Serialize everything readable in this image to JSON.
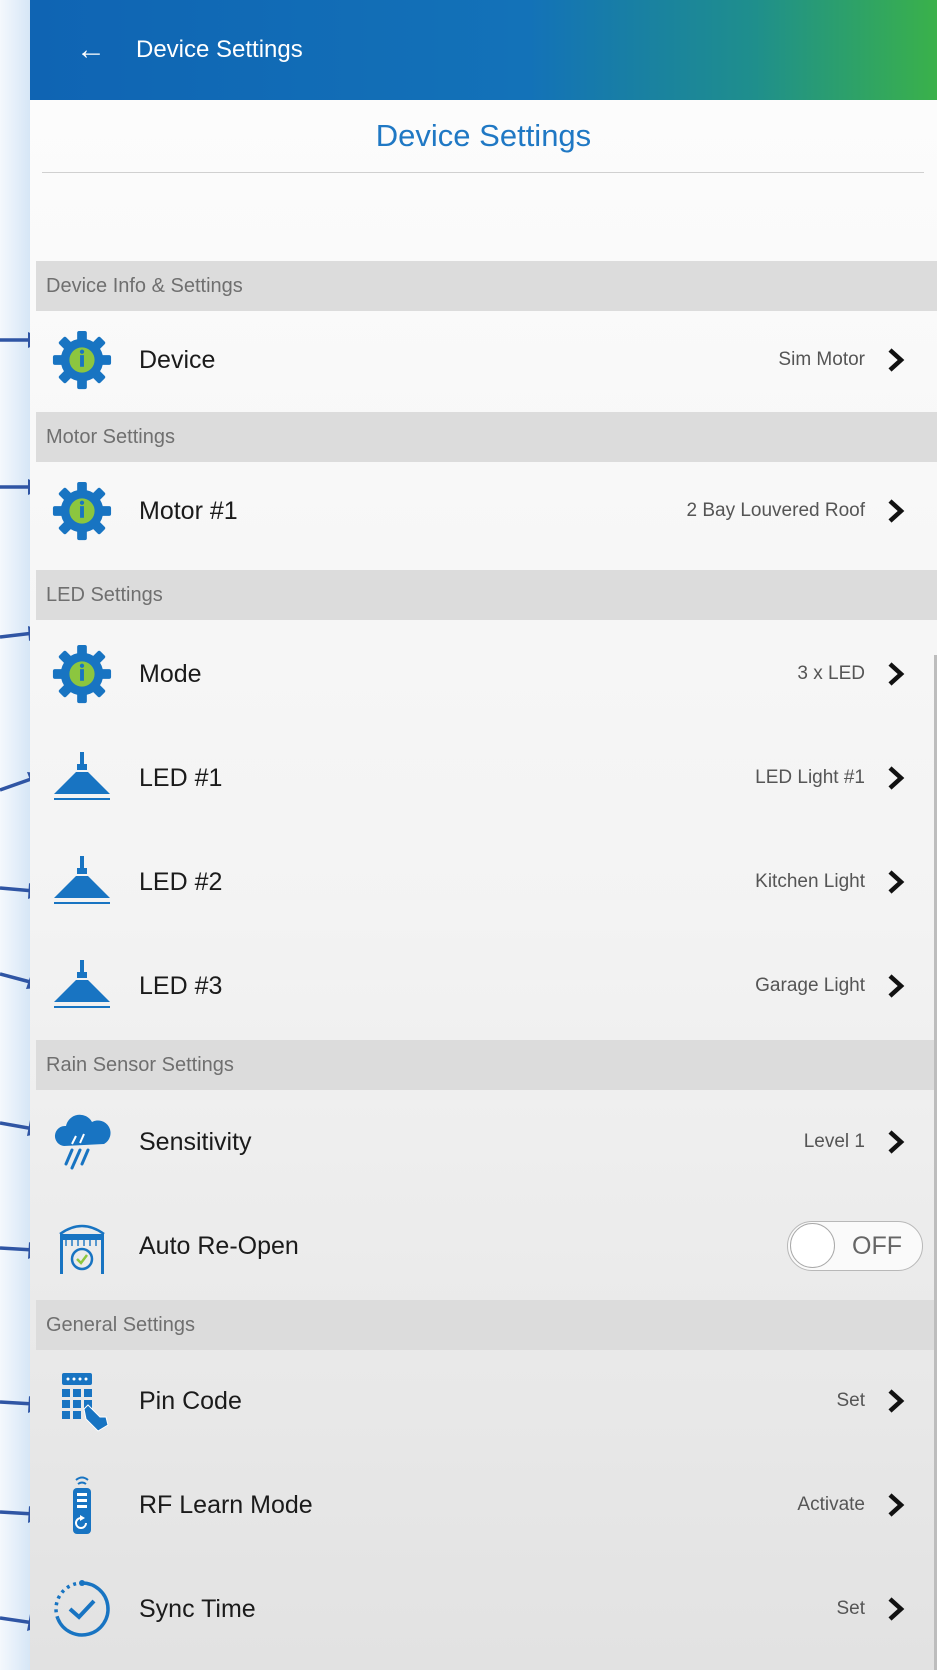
{
  "appbar": {
    "back_icon": "arrow-back-icon",
    "title": "Device Settings"
  },
  "page_title": "Device Settings",
  "sections": {
    "device_info": "Device Info & Settings",
    "motor": "Motor Settings",
    "led": "LED Settings",
    "rain": "Rain Sensor Settings",
    "general": "General Settings"
  },
  "rows": {
    "device": {
      "label": "Device",
      "value": "Sim Motor",
      "icon": "gear-icon"
    },
    "motor1": {
      "label": "Motor #1",
      "value": "2 Bay Louvered Roof",
      "icon": "gear-icon"
    },
    "mode": {
      "label": "Mode",
      "value": "3 x LED",
      "icon": "gear-icon"
    },
    "led1": {
      "label": "LED #1",
      "value": "LED Light #1",
      "icon": "ceiling-light-icon"
    },
    "led2": {
      "label": "LED #2",
      "value": "Kitchen Light",
      "icon": "ceiling-light-icon"
    },
    "led3": {
      "label": "LED #3",
      "value": "Garage Light",
      "icon": "ceiling-light-icon"
    },
    "sensitivity": {
      "label": "Sensitivity",
      "value": "Level 1",
      "icon": "rain-cloud-icon"
    },
    "auto_reopen": {
      "label": "Auto Re-Open",
      "toggle": "OFF",
      "icon": "pergola-timer-icon"
    },
    "pin_code": {
      "label": "Pin Code",
      "value": "Set",
      "icon": "keypad-icon"
    },
    "rf_learn": {
      "label": "RF Learn Mode",
      "value": "Activate",
      "icon": "remote-icon"
    },
    "sync_time": {
      "label": "Sync Time",
      "value": "Set",
      "icon": "clock-sync-icon"
    }
  },
  "colors": {
    "brand_blue": "#1874c2",
    "header_gradient": [
      "#0f64b3",
      "#3ab14a"
    ],
    "accent_green": "#8cc63f",
    "callout_arrow": "#2f55a4"
  }
}
